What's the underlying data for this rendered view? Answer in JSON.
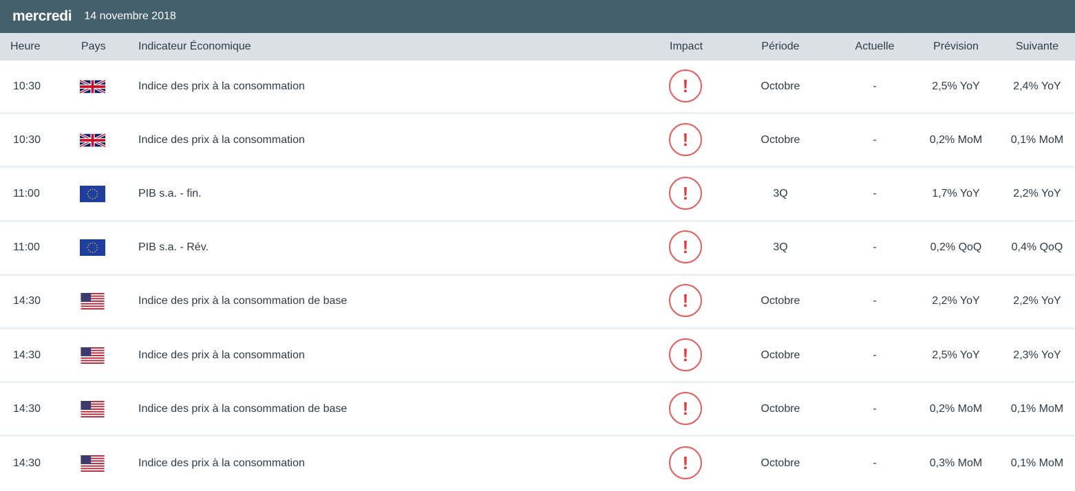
{
  "header": {
    "day_name": "mercredi",
    "date": "14 novembre 2018"
  },
  "columns": {
    "heure": "Heure",
    "pays": "Pays",
    "indicateur": "Indicateur Économique",
    "impact": "Impact",
    "periode": "Période",
    "actuelle": "Actuelle",
    "prevision": "Prévision",
    "suivante": "Suivante"
  },
  "colors": {
    "header_bg": "#44606c",
    "column_header_bg": "#d9e1e6",
    "impact_high": "#ea5a5a"
  },
  "impact_icon": "!",
  "rows": [
    {
      "time": "10:30",
      "country": "uk-flag-icon",
      "indicator": "Indice des prix à la consommation",
      "period": "Octobre",
      "actual": "-",
      "forecast": "2,5% YoY",
      "next": "2,4% YoY"
    },
    {
      "time": "10:30",
      "country": "uk-flag-icon",
      "indicator": "Indice des prix à la consommation",
      "period": "Octobre",
      "actual": "-",
      "forecast": "0,2% MoM",
      "next": "0,1% MoM"
    },
    {
      "time": "11:00",
      "country": "eu-flag-icon",
      "indicator": "PIB s.a. - fin.",
      "period": "3Q",
      "actual": "-",
      "forecast": "1,7% YoY",
      "next": "2,2% YoY"
    },
    {
      "time": "11:00",
      "country": "eu-flag-icon",
      "indicator": "PIB s.a. - Rév.",
      "period": "3Q",
      "actual": "-",
      "forecast": "0,2% QoQ",
      "next": "0,4% QoQ"
    },
    {
      "time": "14:30",
      "country": "us-flag-icon",
      "indicator": "Indice des prix à la consommation de base",
      "period": "Octobre",
      "actual": "-",
      "forecast": "2,2% YoY",
      "next": "2,2% YoY"
    },
    {
      "time": "14:30",
      "country": "us-flag-icon",
      "indicator": "Indice des prix à la consommation",
      "period": "Octobre",
      "actual": "-",
      "forecast": "2,5% YoY",
      "next": "2,3% YoY"
    },
    {
      "time": "14:30",
      "country": "us-flag-icon",
      "indicator": "Indice des prix à la consommation de base",
      "period": "Octobre",
      "actual": "-",
      "forecast": "0,2% MoM",
      "next": "0,1% MoM"
    },
    {
      "time": "14:30",
      "country": "us-flag-icon",
      "indicator": "Indice des prix à la consommation",
      "period": "Octobre",
      "actual": "-",
      "forecast": "0,3% MoM",
      "next": "0,1% MoM"
    }
  ]
}
